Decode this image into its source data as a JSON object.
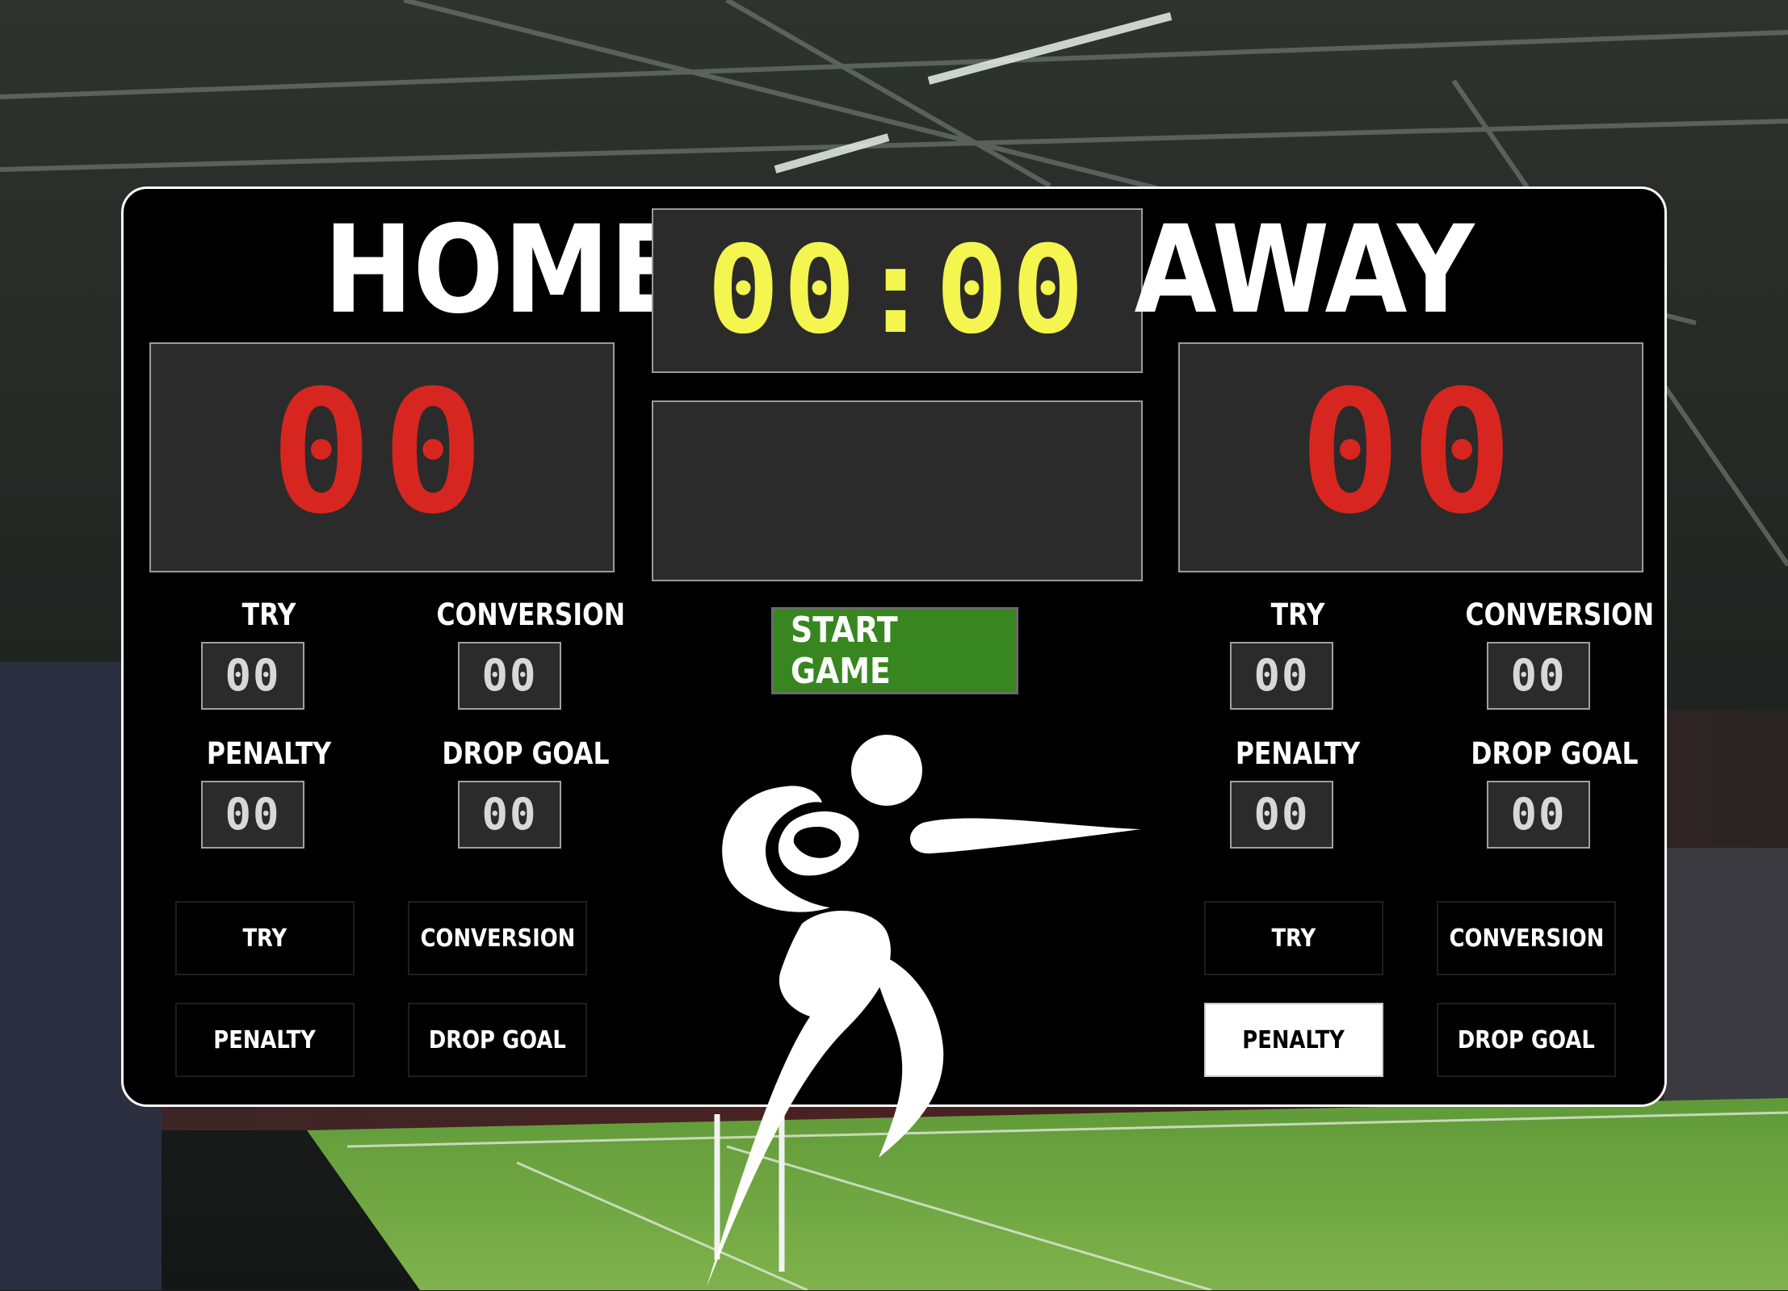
{
  "clock": "00:00",
  "message": "",
  "start_button": "START GAME",
  "home": {
    "name": "HOME",
    "score": "00",
    "stats": [
      {
        "label": "TRY",
        "value": "00"
      },
      {
        "label": "CONVERSION",
        "value": "00"
      },
      {
        "label": "PENALTY",
        "value": "00"
      },
      {
        "label": "DROP GOAL",
        "value": "00"
      }
    ],
    "buttons": [
      "TRY",
      "CONVERSION",
      "PENALTY",
      "DROP GOAL"
    ]
  },
  "away": {
    "name": "AWAY",
    "score": "00",
    "stats": [
      {
        "label": "TRY",
        "value": "00"
      },
      {
        "label": "CONVERSION",
        "value": "00"
      },
      {
        "label": "PENALTY",
        "value": "00"
      },
      {
        "label": "DROP GOAL",
        "value": "00"
      }
    ],
    "buttons": [
      "TRY",
      "CONVERSION",
      "PENALTY",
      "DROP GOAL"
    ]
  },
  "colors": {
    "score_digits": "#d7261f",
    "clock_digits": "#f4f54e",
    "start_button": "#37861f",
    "board": "#000000",
    "panel": "#2b2b2b"
  },
  "icons": [
    "rugby-player-icon"
  ],
  "background": "rugby-stadium-photo",
  "state": {
    "away_penalty_button_highlighted": true
  }
}
